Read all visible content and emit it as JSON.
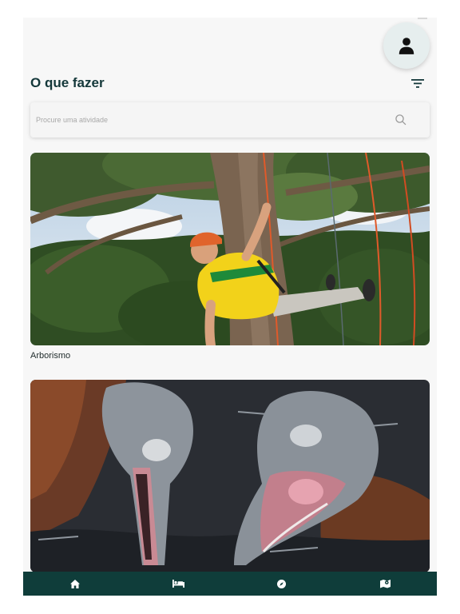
{
  "header": {
    "title": "O que fazer",
    "profile_icon": "user-icon",
    "filter_icon": "filter-icon"
  },
  "search": {
    "placeholder": "Procure uma atividade",
    "value": "",
    "icon": "search-icon"
  },
  "activities": [
    {
      "title": "Arborismo",
      "image": "person in yellow shirt climbing tree canopy with ropes"
    },
    {
      "image": "two pink river dolphins with open mouths in dark water"
    }
  ],
  "bottom_nav": [
    {
      "name": "home",
      "icon": "home-icon"
    },
    {
      "name": "lodging",
      "icon": "bed-icon"
    },
    {
      "name": "explore",
      "icon": "compass-icon"
    },
    {
      "name": "map",
      "icon": "map-icon"
    }
  ],
  "colors": {
    "primary": "#0f3d3a",
    "title": "#14383a",
    "background": "#f7f7f7"
  }
}
